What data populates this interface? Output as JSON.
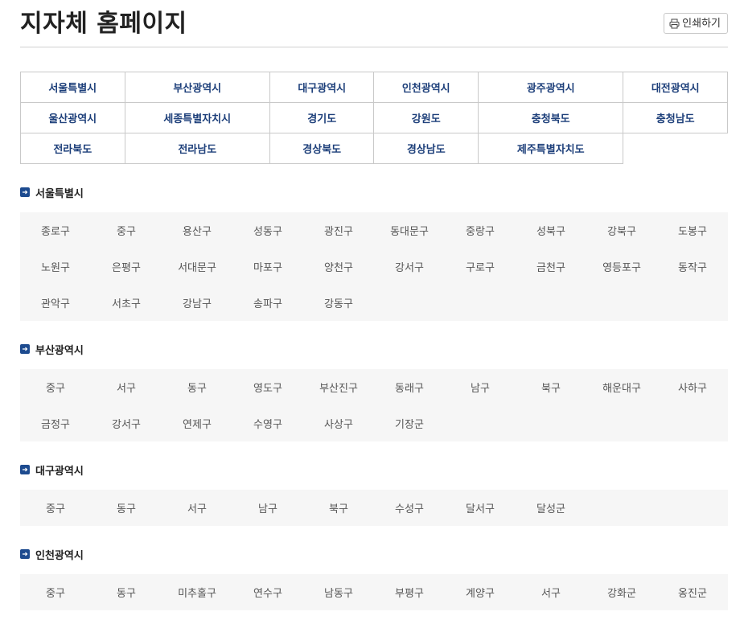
{
  "page": {
    "title": "지자체 홈페이지",
    "print_label": "인쇄하기"
  },
  "regions": [
    [
      "서울특별시",
      "부산광역시",
      "대구광역시",
      "인천광역시",
      "광주광역시",
      "대전광역시"
    ],
    [
      "울산광역시",
      "세종특별자치시",
      "경기도",
      "강원도",
      "충청북도",
      "충청남도"
    ],
    [
      "전라북도",
      "전라남도",
      "경상북도",
      "경상남도",
      "제주특별자치도"
    ]
  ],
  "sections": [
    {
      "title": "서울특별시",
      "rows": [
        [
          "종로구",
          "중구",
          "용산구",
          "성동구",
          "광진구",
          "동대문구",
          "중랑구",
          "성북구",
          "강북구",
          "도봉구"
        ],
        [
          "노원구",
          "은평구",
          "서대문구",
          "마포구",
          "양천구",
          "강서구",
          "구로구",
          "금천구",
          "영등포구",
          "동작구"
        ],
        [
          "관악구",
          "서초구",
          "강남구",
          "송파구",
          "강동구"
        ]
      ]
    },
    {
      "title": "부산광역시",
      "rows": [
        [
          "중구",
          "서구",
          "동구",
          "영도구",
          "부산진구",
          "동래구",
          "남구",
          "북구",
          "해운대구",
          "사하구"
        ],
        [
          "금정구",
          "강서구",
          "연제구",
          "수영구",
          "사상구",
          "기장군"
        ]
      ]
    },
    {
      "title": "대구광역시",
      "rows": [
        [
          "중구",
          "동구",
          "서구",
          "남구",
          "북구",
          "수성구",
          "달서구",
          "달성군"
        ]
      ]
    },
    {
      "title": "인천광역시",
      "rows": [
        [
          "중구",
          "동구",
          "미추홀구",
          "연수구",
          "남동구",
          "부평구",
          "계양구",
          "서구",
          "강화군",
          "옹진군"
        ]
      ]
    }
  ]
}
